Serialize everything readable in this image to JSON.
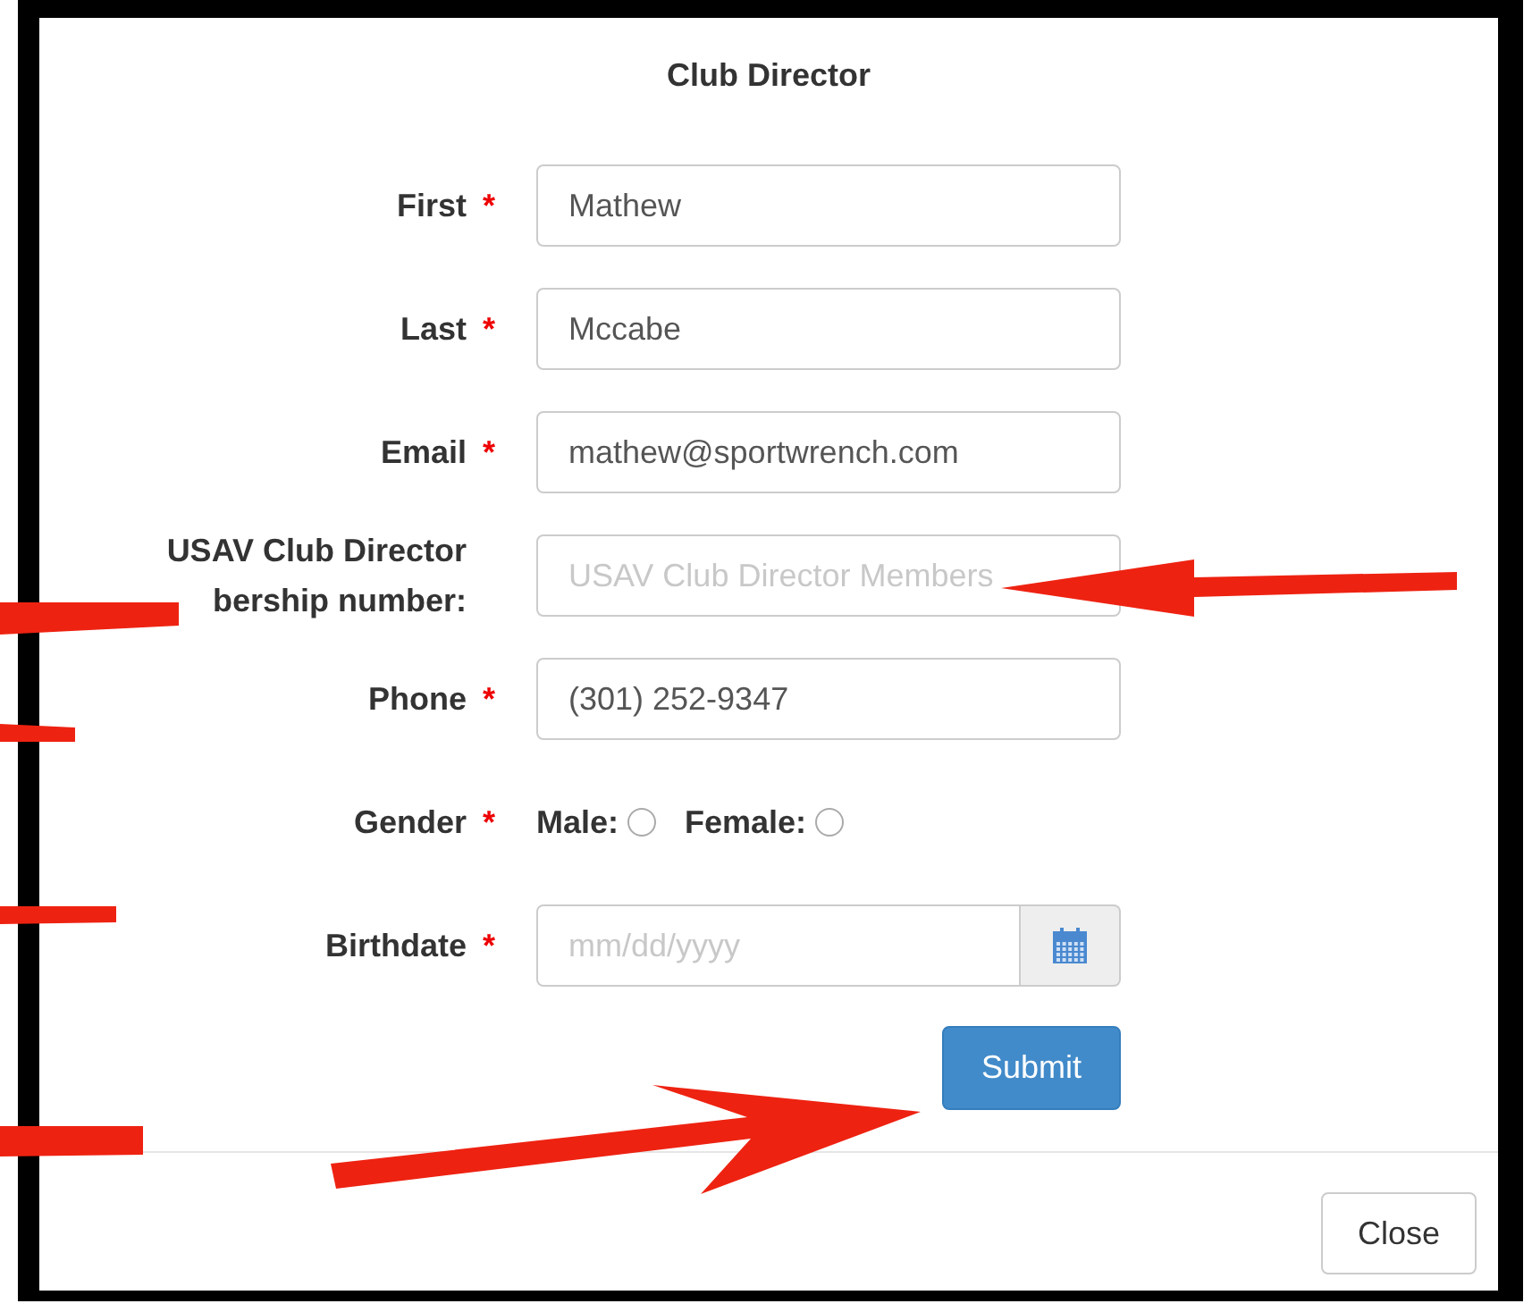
{
  "dialog": {
    "title": "Club Director"
  },
  "required_mark": "*",
  "fields": [
    {
      "kind": "text",
      "label_lines": [
        "First"
      ],
      "required": true,
      "value": "Mathew"
    },
    {
      "kind": "text",
      "label_lines": [
        "Last"
      ],
      "required": true,
      "value": "Mccabe"
    },
    {
      "kind": "text",
      "label_lines": [
        "Email"
      ],
      "required": true,
      "value": "mathew@sportwrench.com"
    },
    {
      "kind": "text",
      "label_lines": [
        "USAV Club Director",
        "bership number:"
      ],
      "required": false,
      "placeholder": "USAV Club Director Members"
    },
    {
      "kind": "text",
      "label_lines": [
        "Phone"
      ],
      "required": true,
      "value": "(301) 252-9347"
    },
    {
      "kind": "radio",
      "label_lines": [
        "Gender"
      ],
      "required": true,
      "options": [
        {
          "label": "Male:",
          "selected": false
        },
        {
          "label": "Female:",
          "selected": false
        }
      ]
    },
    {
      "kind": "date",
      "label_lines": [
        "Birthdate"
      ],
      "required": true,
      "placeholder": "mm/dd/yyyy"
    }
  ],
  "submit_button": "Submit",
  "close_button": "Close"
}
